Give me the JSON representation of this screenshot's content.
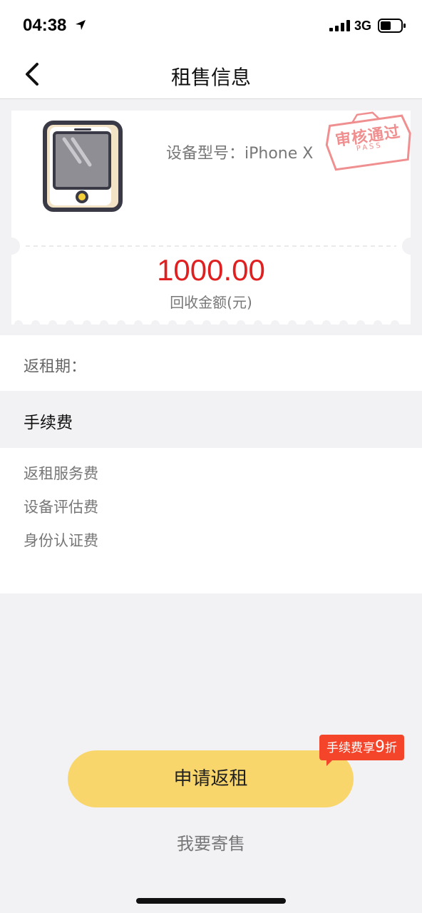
{
  "status_bar": {
    "time": "04:38",
    "network": "3G",
    "icons": [
      "location-arrow-icon",
      "signal-bars-icon",
      "battery-icon"
    ]
  },
  "nav": {
    "title": "租售信息",
    "back_icon": "chevron-left-icon"
  },
  "device": {
    "icon": "tablet-icon",
    "model_label": "设备型号：iPhone X",
    "stamp": {
      "main": "审核通过",
      "sub": "PASS"
    },
    "amount": "1000.00",
    "amount_label": "回收金额(元)"
  },
  "period": {
    "label": "返租期："
  },
  "fees": {
    "title": "手续费",
    "items": [
      "返租服务费",
      "设备评估费",
      "身份认证费"
    ]
  },
  "actions": {
    "apply_label": "申请返租",
    "badge_text": "手续费享",
    "badge_number": "9",
    "badge_suffix": "折",
    "consign_label": "我要寄售"
  },
  "colors": {
    "accent_yellow": "#f9d66c",
    "amount_red": "#e02020",
    "badge_red": "#f4442a",
    "stamp_pink": "#f08f8f"
  }
}
